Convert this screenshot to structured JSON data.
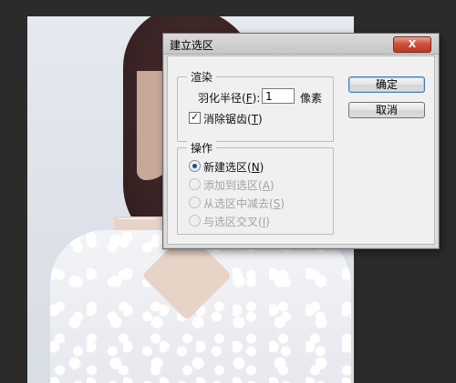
{
  "dialog": {
    "title": "建立选区",
    "close_label": "X",
    "render_group": {
      "title": "渲染",
      "feather_label": "羽化半径(",
      "feather_key": "F",
      "feather_suffix": "):",
      "feather_value": "1",
      "feather_unit": "像素",
      "antialias_label": "消除锯齿(",
      "antialias_key": "T",
      "antialias_suffix": ")",
      "antialias_checked": true
    },
    "operation_group": {
      "title": "操作",
      "options": [
        {
          "label": "新建选区(",
          "key": "N",
          "suffix": ")",
          "checked": true,
          "enabled": true
        },
        {
          "label": "添加到选区(",
          "key": "A",
          "suffix": ")",
          "checked": false,
          "enabled": false
        },
        {
          "label": "从选区中减去(",
          "key": "S",
          "suffix": ")",
          "checked": false,
          "enabled": false
        },
        {
          "label": "与选区交叉(",
          "key": "I",
          "suffix": ")",
          "checked": false,
          "enabled": false
        }
      ]
    },
    "ok_label": "确定",
    "cancel_label": "取消"
  }
}
